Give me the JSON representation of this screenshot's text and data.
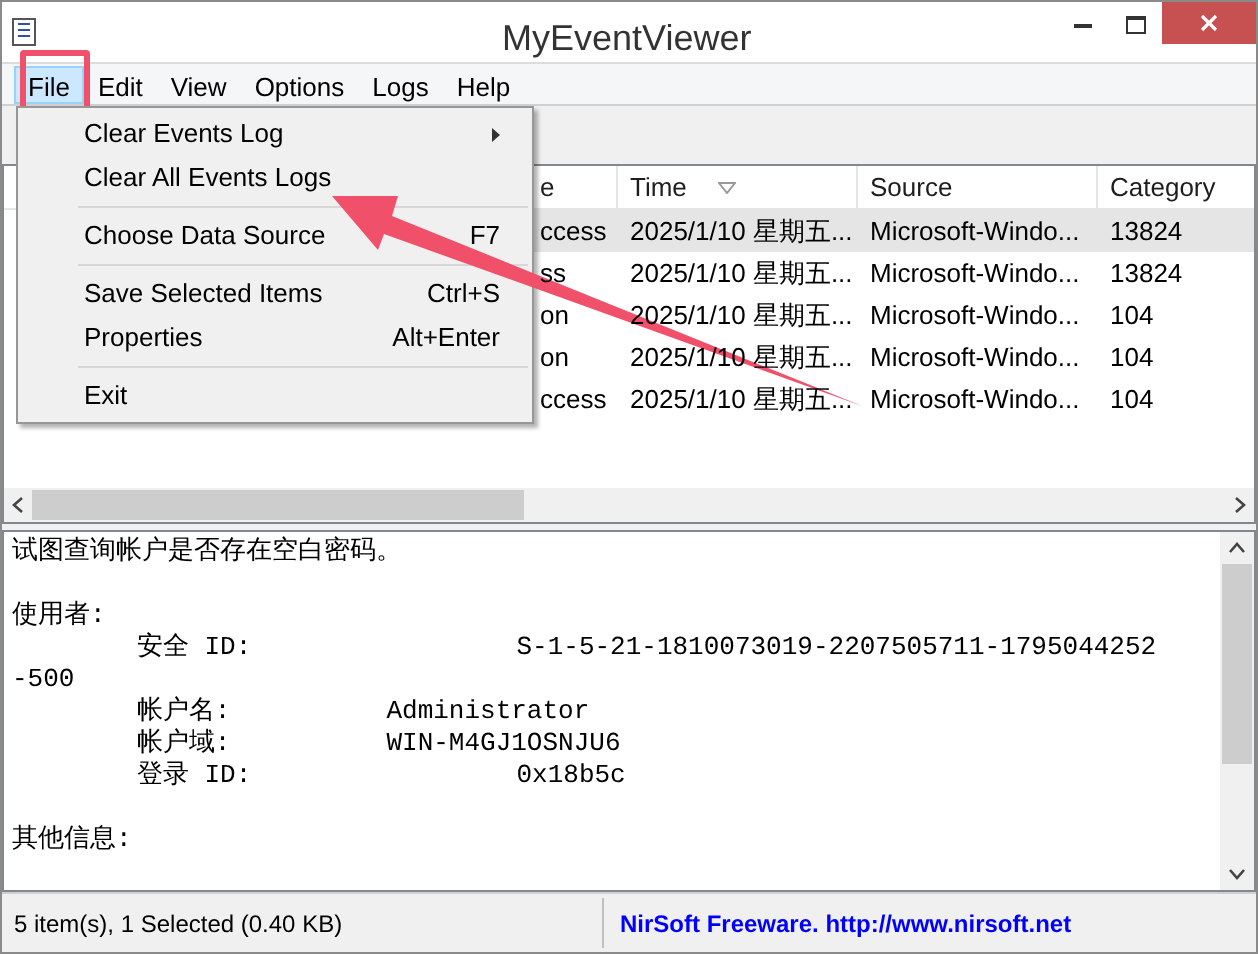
{
  "window": {
    "title": "MyEventViewer"
  },
  "menu_bar": [
    {
      "label": "File",
      "selected": true
    },
    {
      "label": "Edit",
      "selected": false
    },
    {
      "label": "View",
      "selected": false
    },
    {
      "label": "Options",
      "selected": false
    },
    {
      "label": "Logs",
      "selected": false
    },
    {
      "label": "Help",
      "selected": false
    }
  ],
  "file_menu": [
    {
      "kind": "item",
      "label": "Clear Events Log",
      "submenu": true
    },
    {
      "kind": "item",
      "label": "Clear All Events Logs"
    },
    {
      "kind": "separator"
    },
    {
      "kind": "item",
      "label": "Choose Data Source",
      "shortcut": "F7"
    },
    {
      "kind": "separator"
    },
    {
      "kind": "item",
      "label": "Save Selected Items",
      "shortcut": "Ctrl+S"
    },
    {
      "kind": "item",
      "label": "Properties",
      "shortcut": "Alt+Enter"
    },
    {
      "kind": "separator"
    },
    {
      "kind": "item",
      "label": "Exit"
    }
  ],
  "table": {
    "columns": [
      "e",
      "Time",
      "Source",
      "Category"
    ],
    "rows": [
      {
        "selected": true,
        "cells": [
          "ccess",
          "2025/1/10 星期五...",
          "Microsoft-Windo...",
          "13824"
        ]
      },
      {
        "selected": false,
        "cells": [
          "ss",
          "2025/1/10 星期五...",
          "Microsoft-Windo...",
          "13824"
        ]
      },
      {
        "selected": false,
        "cells": [
          "on",
          "2025/1/10 星期五...",
          "Microsoft-Windo...",
          "104"
        ]
      },
      {
        "selected": false,
        "cells": [
          "on",
          "2025/1/10 星期五...",
          "Microsoft-Windo...",
          "104"
        ]
      },
      {
        "selected": false,
        "cells": [
          "ccess",
          "2025/1/10 星期五...",
          "Microsoft-Windo...",
          "104"
        ]
      }
    ]
  },
  "details": [
    [
      "试图查询帐户是否存在空白密码。"
    ],
    [
      "使用者:",
      "        安全 ID:                 S-1-5-21-1810073019-2207505711-1795044252",
      "-500",
      "        帐户名:          Administrator",
      "        帐户域:          WIN-M4GJ1OSNJU6",
      "        登录 ID:                 0x18b5c"
    ],
    [
      "其他信息:"
    ]
  ],
  "status_bar": {
    "summary": "5 item(s), 1 Selected  (0.40 KB)",
    "link": "NirSoft Freeware.  http://www.nirsoft.net"
  }
}
